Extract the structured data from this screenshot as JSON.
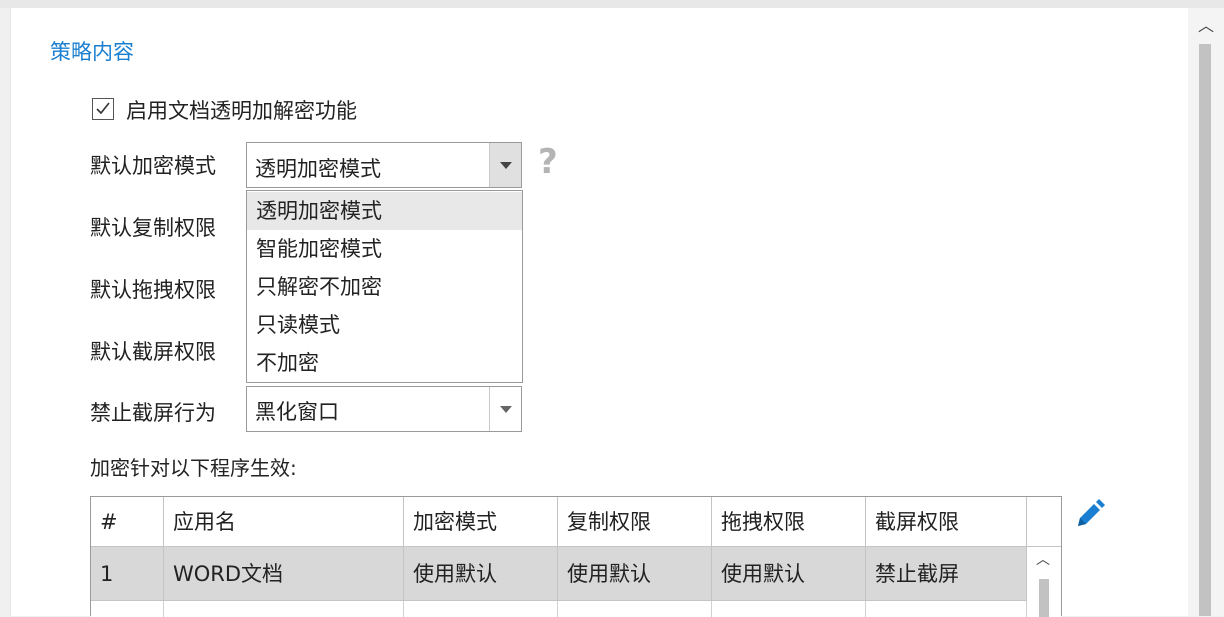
{
  "section_title": "策略内容",
  "enable_checkbox": {
    "label": "启用文档透明加解密功能",
    "checked": true
  },
  "form": {
    "default_encrypt_mode_label": "默认加密模式",
    "default_encrypt_mode_value": "透明加密模式",
    "default_copy_label": "默认复制权限",
    "default_drag_label": "默认拖拽权限",
    "default_screenshot_label": "默认截屏权限",
    "forbid_screenshot_label": "禁止截屏行为",
    "forbid_screenshot_value": "黑化窗口"
  },
  "dropdown_options": [
    "透明加密模式",
    "智能加密模式",
    "只解密不加密",
    "只读模式",
    "不加密"
  ],
  "dropdown_selected_index": 0,
  "programs_label": "加密针对以下程序生效:",
  "table": {
    "columns": [
      "#",
      "应用名",
      "加密模式",
      "复制权限",
      "拖拽权限",
      "截屏权限"
    ],
    "rows": [
      [
        "1",
        "WORD文档",
        "使用默认",
        "使用默认",
        "使用默认",
        "禁止截屏"
      ]
    ]
  },
  "icons": {
    "help": "help-question-icon",
    "edit": "pencil-edit-icon",
    "scroll_up": "chevron-up-icon",
    "check": "checkmark-icon"
  },
  "colors": {
    "accent": "#1a7fd0",
    "selected_row": "#d8d8d8",
    "help_icon": "#b4b4b4"
  }
}
